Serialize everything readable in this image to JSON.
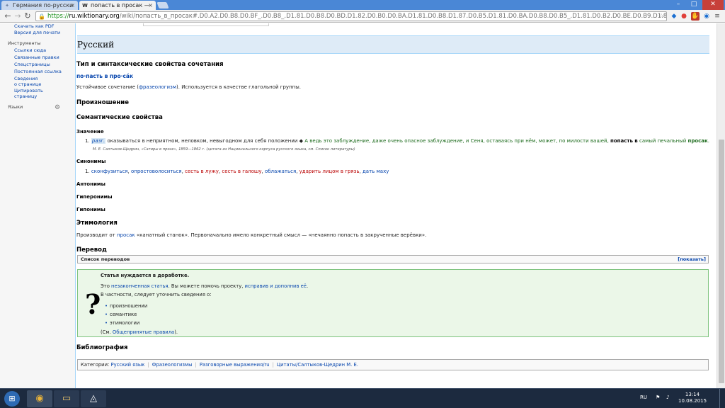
{
  "browser": {
    "tabs": [
      {
        "title": "Германия по-русски"
      },
      {
        "title": "попасть в просак —"
      }
    ],
    "url": {
      "protocol": "https://",
      "host": "ru.wiktionary.org",
      "path": "/wiki/попасть_в_просак#.D0.A2.D0.B8.D0.BF_.D0.B8_.D1.81.D0.B8.D0.BD.D1.82.D0.B0.D0.BA.D1.81.D0.B8.D1.87.D0.B5.D1.81.D0.BA.D0.B8.D0.B5_.D1.81.D0.B2.D0.BE.D0.B9.D1.81.D1.82.D0.B2.D0.B0_.D1.81.D0.BE.D1"
    }
  },
  "sidebar": {
    "top_items": [
      "Скачать как PDF",
      "Версия для печати"
    ],
    "tools_heading": "Инструменты",
    "tools": [
      "Ссылки сюда",
      "Связанные правки",
      "Спецстраницы",
      "Постоянная ссылка",
      "Сведения\nо странице",
      "Цитировать\nстраницу"
    ],
    "languages_heading": "Языки"
  },
  "article": {
    "language": "Русский",
    "type_heading": "Тип и синтаксические свойства сочетания",
    "headword": "по·пасть в про·са́к",
    "type_text_pre": "Устойчивое сочетание (",
    "type_text_link": "фразеологизм",
    "type_text_post": "). Используется в качестве глагольной группы.",
    "pron_heading": "Произношение",
    "sem_heading": "Семантические свойства",
    "meaning_heading": "Значение",
    "meaning_num": "1.",
    "meaning_label": "разг.",
    "meaning_text": " оказываться в неприятном, неловком, невыгодном для себя положении ◆ ",
    "example_text": "А ведь это заблуждение, даже очень опасное заблуждение, и Сеня, оставаясь при нём, может, по милости вашей, ",
    "example_bold1": "попасть в",
    "example_mid": " самый печальный ",
    "example_bold2": "просак",
    "example_end": ".",
    "citation": "М. Е. Салтыков-Щедрин, «Сатиры в прозе», 1859—1862 г. (цитата из Национального корпуса русского языка, см. Список литературы)",
    "synonyms_heading": "Синонимы",
    "synonyms_num": "1.",
    "synonyms": [
      {
        "text": "сконфузиться",
        "red": false
      },
      {
        "text": "опростоволоситься",
        "red": false
      },
      {
        "text": "сесть в лужу",
        "red": true
      },
      {
        "text": "сесть в галошу",
        "red": true
      },
      {
        "text": "облажаться",
        "red": false
      },
      {
        "text": "ударить лицом в грязь",
        "red": true
      },
      {
        "text": "дать маху",
        "red": false
      }
    ],
    "antonyms_heading": "Антонимы",
    "hyperonyms_heading": "Гиперонимы",
    "hyponyms_heading": "Гипонимы",
    "etym_heading": "Этимология",
    "etym_pre": "Производит от ",
    "etym_link": "просак",
    "etym_post": " «канатный станок». Первоначально имело конкретный смысл — «нечаянно попасть в закрученные верёвки».",
    "trans_heading": "Перевод",
    "trans_box_title": "Список переводов",
    "trans_box_show": "[показать]",
    "notice": {
      "title": "Статья нуждается в доработке.",
      "line1_pre": "Это ",
      "line1_link1": "незаконченная статья",
      "line1_mid": ". Вы можете помочь проекту, ",
      "line1_link2": "исправив и дополнив её",
      "line1_end": ".",
      "line2": "В частности, следует уточнить сведения о:",
      "items": [
        "произношении",
        "семантике",
        "этимологии"
      ],
      "see_pre": "(См. ",
      "see_link": "Общепринятые правила",
      "see_post": ")."
    },
    "biblio_heading": "Библиография",
    "categories_label": "Категории:",
    "categories": [
      "Русский язык",
      "Фразеологизмы",
      "Разговорные выражения/ru",
      "Цитаты/Салтыков-Щедрин М. Е."
    ]
  },
  "taskbar": {
    "lang": "RU",
    "time": "13:14",
    "date": "10.08.2015"
  },
  "colors": {
    "link": "#0645ad",
    "redlink": "#ba0000",
    "example": "#1d6b1d",
    "lang_bar": "#deebf7",
    "notice_bg": "#ebf7e8"
  }
}
